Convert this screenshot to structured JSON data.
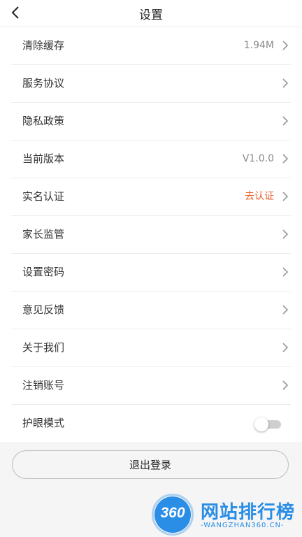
{
  "header": {
    "title": "设置"
  },
  "settings": {
    "items": [
      {
        "label": "清除缓存",
        "value": "1.94M"
      },
      {
        "label": "服务协议"
      },
      {
        "label": "隐私政策"
      },
      {
        "label": "当前版本",
        "value": "V1.0.0"
      },
      {
        "label": "实名认证",
        "value": "去认证"
      },
      {
        "label": "家长监管"
      },
      {
        "label": "设置密码"
      },
      {
        "label": "意见反馈"
      },
      {
        "label": "关于我们"
      },
      {
        "label": "注销账号"
      },
      {
        "label": "护眼模式",
        "toggle_on": false
      }
    ]
  },
  "logout": {
    "label": "退出登录"
  },
  "watermark": {
    "number": "360",
    "name": "网站排行榜",
    "url": "-WANGZHAN360.CN-"
  },
  "colors": {
    "accent": "#e8612c",
    "brand": "#2a8de6",
    "background": "#f5f5f5"
  }
}
